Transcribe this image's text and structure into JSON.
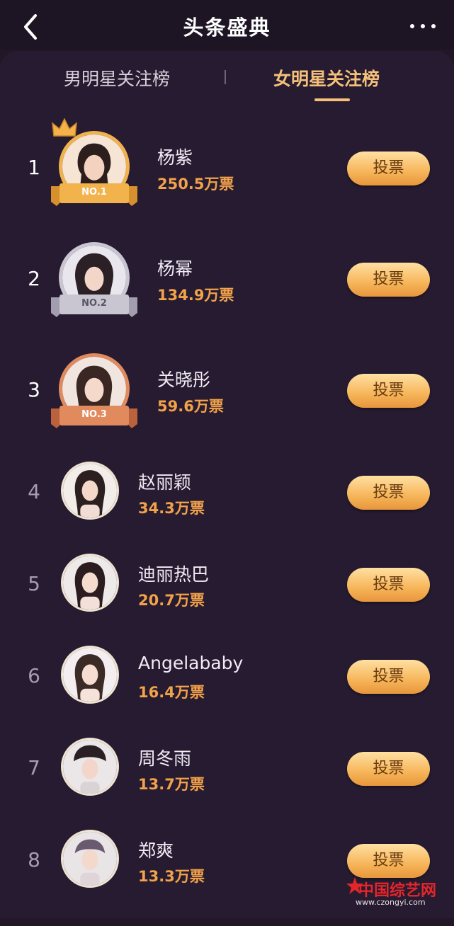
{
  "header": {
    "title": "头条盛典"
  },
  "tabs": [
    {
      "label": "男明星关注榜",
      "active": false
    },
    {
      "label": "女明星关注榜",
      "active": true
    }
  ],
  "vote_label": "投票",
  "ranking": [
    {
      "rank": "1",
      "name": "杨紫",
      "votes": "250.5万票",
      "badge": "NO.1"
    },
    {
      "rank": "2",
      "name": "杨幂",
      "votes": "134.9万票",
      "badge": "NO.2"
    },
    {
      "rank": "3",
      "name": "关晓彤",
      "votes": "59.6万票",
      "badge": "NO.3"
    },
    {
      "rank": "4",
      "name": "赵丽颖",
      "votes": "34.3万票"
    },
    {
      "rank": "5",
      "name": "迪丽热巴",
      "votes": "20.7万票"
    },
    {
      "rank": "6",
      "name": "Angelababy",
      "votes": "16.4万票"
    },
    {
      "rank": "7",
      "name": "周冬雨",
      "votes": "13.7万票"
    },
    {
      "rank": "8",
      "name": "郑爽",
      "votes": "13.3万票"
    }
  ],
  "watermark": {
    "text": "中国综艺网",
    "url": "www.czongyi.com"
  },
  "colors": {
    "background": "#211727",
    "accent": "#f4c07a",
    "votes": "#f2a24a",
    "gold": "#f0b24e",
    "silver": "#c9c6d1",
    "bronze": "#e08a5e"
  }
}
